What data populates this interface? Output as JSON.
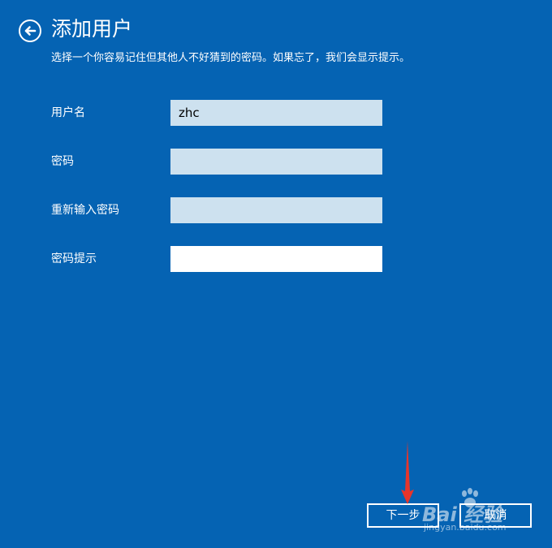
{
  "header": {
    "title": "添加用户",
    "subtitle": "选择一个你容易记住但其他人不好猜到的密码。如果忘了，我们会显示提示。"
  },
  "form": {
    "username": {
      "label": "用户名",
      "value": "zhc"
    },
    "password": {
      "label": "密码",
      "value": ""
    },
    "password_confirm": {
      "label": "重新输入密码",
      "value": ""
    },
    "password_hint": {
      "label": "密码提示",
      "value": ""
    }
  },
  "buttons": {
    "next_label": "下一步",
    "cancel_label": "取消"
  },
  "annotation": {
    "arrow_color": "#e8352b"
  },
  "watermark": {
    "brand": "Bai 经验",
    "url": "jingyan.baidu.com"
  },
  "colors": {
    "background": "#0563b3",
    "input_fill": "#cde1ef",
    "input_active": "#ffffff"
  }
}
